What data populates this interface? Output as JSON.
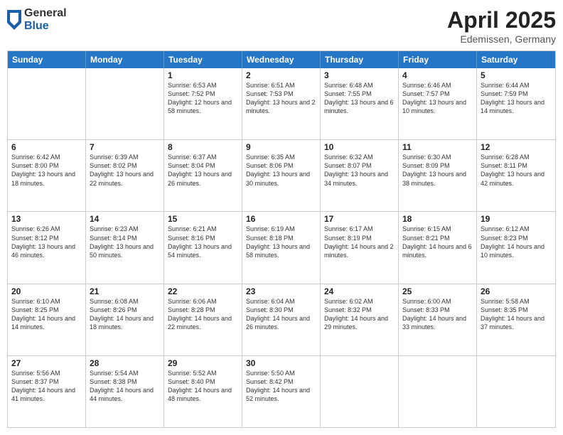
{
  "logo": {
    "general": "General",
    "blue": "Blue"
  },
  "title": {
    "month": "April 2025",
    "location": "Edemissen, Germany"
  },
  "header_days": [
    "Sunday",
    "Monday",
    "Tuesday",
    "Wednesday",
    "Thursday",
    "Friday",
    "Saturday"
  ],
  "weeks": [
    [
      {
        "day": "",
        "info": ""
      },
      {
        "day": "",
        "info": ""
      },
      {
        "day": "1",
        "info": "Sunrise: 6:53 AM\nSunset: 7:52 PM\nDaylight: 12 hours\nand 58 minutes."
      },
      {
        "day": "2",
        "info": "Sunrise: 6:51 AM\nSunset: 7:53 PM\nDaylight: 13 hours\nand 2 minutes."
      },
      {
        "day": "3",
        "info": "Sunrise: 6:48 AM\nSunset: 7:55 PM\nDaylight: 13 hours\nand 6 minutes."
      },
      {
        "day": "4",
        "info": "Sunrise: 6:46 AM\nSunset: 7:57 PM\nDaylight: 13 hours\nand 10 minutes."
      },
      {
        "day": "5",
        "info": "Sunrise: 6:44 AM\nSunset: 7:59 PM\nDaylight: 13 hours\nand 14 minutes."
      }
    ],
    [
      {
        "day": "6",
        "info": "Sunrise: 6:42 AM\nSunset: 8:00 PM\nDaylight: 13 hours\nand 18 minutes."
      },
      {
        "day": "7",
        "info": "Sunrise: 6:39 AM\nSunset: 8:02 PM\nDaylight: 13 hours\nand 22 minutes."
      },
      {
        "day": "8",
        "info": "Sunrise: 6:37 AM\nSunset: 8:04 PM\nDaylight: 13 hours\nand 26 minutes."
      },
      {
        "day": "9",
        "info": "Sunrise: 6:35 AM\nSunset: 8:06 PM\nDaylight: 13 hours\nand 30 minutes."
      },
      {
        "day": "10",
        "info": "Sunrise: 6:32 AM\nSunset: 8:07 PM\nDaylight: 13 hours\nand 34 minutes."
      },
      {
        "day": "11",
        "info": "Sunrise: 6:30 AM\nSunset: 8:09 PM\nDaylight: 13 hours\nand 38 minutes."
      },
      {
        "day": "12",
        "info": "Sunrise: 6:28 AM\nSunset: 8:11 PM\nDaylight: 13 hours\nand 42 minutes."
      }
    ],
    [
      {
        "day": "13",
        "info": "Sunrise: 6:26 AM\nSunset: 8:12 PM\nDaylight: 13 hours\nand 46 minutes."
      },
      {
        "day": "14",
        "info": "Sunrise: 6:23 AM\nSunset: 8:14 PM\nDaylight: 13 hours\nand 50 minutes."
      },
      {
        "day": "15",
        "info": "Sunrise: 6:21 AM\nSunset: 8:16 PM\nDaylight: 13 hours\nand 54 minutes."
      },
      {
        "day": "16",
        "info": "Sunrise: 6:19 AM\nSunset: 8:18 PM\nDaylight: 13 hours\nand 58 minutes."
      },
      {
        "day": "17",
        "info": "Sunrise: 6:17 AM\nSunset: 8:19 PM\nDaylight: 14 hours\nand 2 minutes."
      },
      {
        "day": "18",
        "info": "Sunrise: 6:15 AM\nSunset: 8:21 PM\nDaylight: 14 hours\nand 6 minutes."
      },
      {
        "day": "19",
        "info": "Sunrise: 6:12 AM\nSunset: 8:23 PM\nDaylight: 14 hours\nand 10 minutes."
      }
    ],
    [
      {
        "day": "20",
        "info": "Sunrise: 6:10 AM\nSunset: 8:25 PM\nDaylight: 14 hours\nand 14 minutes."
      },
      {
        "day": "21",
        "info": "Sunrise: 6:08 AM\nSunset: 8:26 PM\nDaylight: 14 hours\nand 18 minutes."
      },
      {
        "day": "22",
        "info": "Sunrise: 6:06 AM\nSunset: 8:28 PM\nDaylight: 14 hours\nand 22 minutes."
      },
      {
        "day": "23",
        "info": "Sunrise: 6:04 AM\nSunset: 8:30 PM\nDaylight: 14 hours\nand 26 minutes."
      },
      {
        "day": "24",
        "info": "Sunrise: 6:02 AM\nSunset: 8:32 PM\nDaylight: 14 hours\nand 29 minutes."
      },
      {
        "day": "25",
        "info": "Sunrise: 6:00 AM\nSunset: 8:33 PM\nDaylight: 14 hours\nand 33 minutes."
      },
      {
        "day": "26",
        "info": "Sunrise: 5:58 AM\nSunset: 8:35 PM\nDaylight: 14 hours\nand 37 minutes."
      }
    ],
    [
      {
        "day": "27",
        "info": "Sunrise: 5:56 AM\nSunset: 8:37 PM\nDaylight: 14 hours\nand 41 minutes."
      },
      {
        "day": "28",
        "info": "Sunrise: 5:54 AM\nSunset: 8:38 PM\nDaylight: 14 hours\nand 44 minutes."
      },
      {
        "day": "29",
        "info": "Sunrise: 5:52 AM\nSunset: 8:40 PM\nDaylight: 14 hours\nand 48 minutes."
      },
      {
        "day": "30",
        "info": "Sunrise: 5:50 AM\nSunset: 8:42 PM\nDaylight: 14 hours\nand 52 minutes."
      },
      {
        "day": "",
        "info": ""
      },
      {
        "day": "",
        "info": ""
      },
      {
        "day": "",
        "info": ""
      }
    ]
  ]
}
